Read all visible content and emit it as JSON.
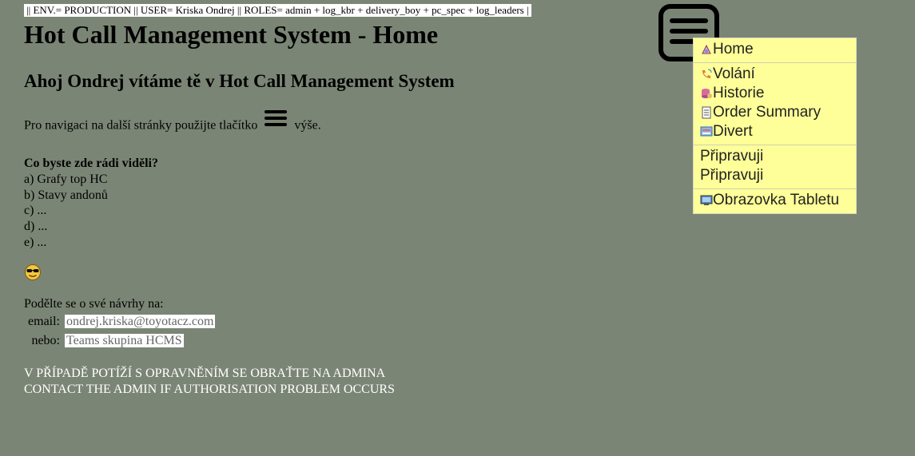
{
  "env_bar": "|| ENV.= PRODUCTION || USER= Kriska Ondrej || ROLES= admin + log_kbr + delivery_boy + pc_spec + log_leaders |",
  "title": "Hot Call Management System - Home",
  "welcome": "Ahoj Ondrej vítáme tě v Hot Call Management System",
  "nav_hint": {
    "before": "Pro navigaci na další stránky použijte tlačítko",
    "after": "výše."
  },
  "wishes": {
    "heading": "Co byste zde rádi viděli?",
    "items": [
      "a) Grafy top HC",
      "b) Stavy andonů",
      "c) ...",
      "d) ...",
      "e) ..."
    ]
  },
  "suggest_label": "Podělte se o své návrhy na:",
  "contacts": {
    "email_label": "email:",
    "email_value": "ondrej.kriska@toyotacz.com",
    "or_label": "nebo:",
    "teams_value": "Teams skupina HCMS"
  },
  "warning": {
    "line1": "V PŘÍPADĚ POTÍŽÍ S OPRAVNĚNÍM SE OBRAŤTE NA ADMINA",
    "line2": "CONTACT THE ADMIN IF AUTHORISATION PROBLEM OCCURS"
  },
  "menu": {
    "groups": [
      [
        {
          "label": "Home",
          "icon": "home-icon"
        }
      ],
      [
        {
          "label": "Volání",
          "icon": "phone-icon"
        },
        {
          "label": "Historie",
          "icon": "database-icon"
        },
        {
          "label": "Order Summary",
          "icon": "document-icon"
        },
        {
          "label": "Divert",
          "icon": "divert-icon"
        }
      ],
      [
        {
          "label": "Připravuji",
          "icon": ""
        },
        {
          "label": "Připravuji",
          "icon": ""
        }
      ],
      [
        {
          "label": "Obrazovka Tabletu",
          "icon": "monitor-icon"
        }
      ]
    ]
  },
  "colors": {
    "background": "#7b8575",
    "menu_bg": "#ffff99",
    "warning_text": "#ffffff"
  }
}
